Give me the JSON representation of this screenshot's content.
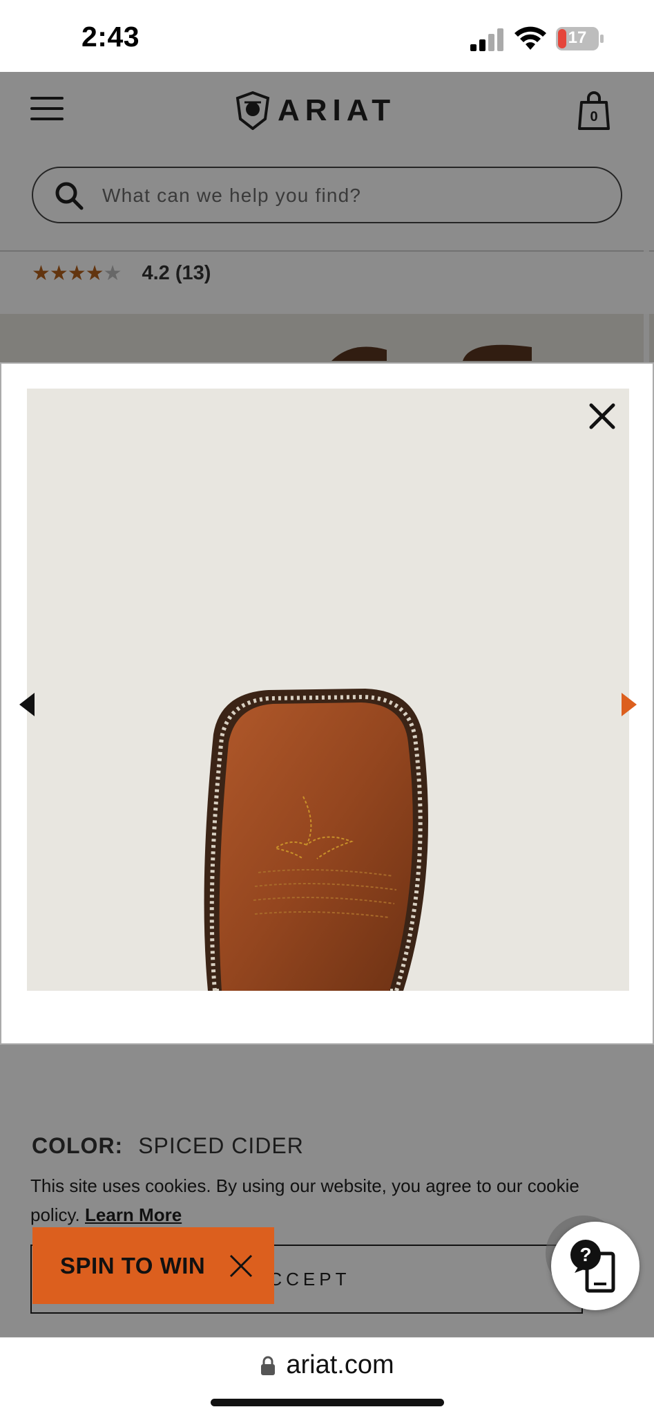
{
  "status_bar": {
    "time": "2:43",
    "battery": "17"
  },
  "header": {
    "brand": "ARIAT",
    "cart_count": "0",
    "search_placeholder": "What can we help you find?"
  },
  "product": {
    "rating_value": "4.2",
    "review_count": "(13)",
    "rating_text": "4.2 (13)",
    "stars_filled": 4,
    "color_label": "COLOR:",
    "color_value": "SPICED CIDER"
  },
  "cookie_banner": {
    "text": "This site uses cookies. By using our website, you agree to our cookie policy.",
    "link": "Learn More",
    "accept": "ACCEPT"
  },
  "promo": {
    "label": "SPIN TO WIN"
  },
  "browser": {
    "url": "ariat.com"
  },
  "colors": {
    "brand_orange": "#dc5f1e",
    "star": "#b5611d",
    "image_bg": "#e8e6e0"
  }
}
